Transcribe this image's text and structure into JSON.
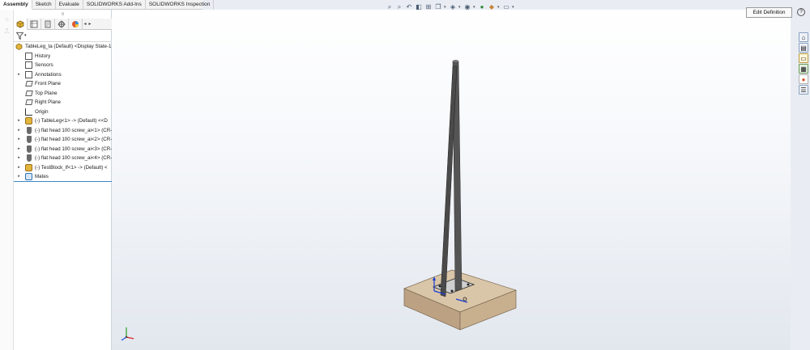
{
  "tabs": [
    {
      "label": "Assembly",
      "active": true
    },
    {
      "label": "Sketch",
      "active": false
    },
    {
      "label": "Evaluate",
      "active": false
    },
    {
      "label": "SOLIDWORKS Add-Ins",
      "active": false
    },
    {
      "label": "SOLIDWORKS Inspection",
      "active": false
    }
  ],
  "panel": {
    "grip": "¤",
    "tab_icons": [
      "feature-manager-icon",
      "property-manager-icon",
      "configuration-manager-icon",
      "dimxpert-manager-icon",
      "display-manager-icon"
    ],
    "tree": [
      {
        "label": "TableLeg_ta (Default) <Display State-1",
        "icon": "assembly-icon",
        "expander": false,
        "level": 0
      },
      {
        "label": "History",
        "icon": "history-icon",
        "expander": false,
        "level": 1
      },
      {
        "label": "Sensors",
        "icon": "sensors-icon",
        "expander": false,
        "level": 1
      },
      {
        "label": "Annotations",
        "icon": "annotations-icon",
        "expander": true,
        "level": 1
      },
      {
        "label": "Front Plane",
        "icon": "plane-icon",
        "expander": false,
        "level": 1
      },
      {
        "label": "Top Plane",
        "icon": "plane-icon",
        "expander": false,
        "level": 1
      },
      {
        "label": "Right Plane",
        "icon": "plane-icon",
        "expander": false,
        "level": 1
      },
      {
        "label": "Origin",
        "icon": "origin-icon",
        "expander": false,
        "level": 1
      },
      {
        "label": "(-) TableLeg<1> -> (Default) <<D",
        "icon": "part-icon",
        "expander": true,
        "level": 1
      },
      {
        "label": "(-) flat head 100 screw_ai<1> (CR-",
        "icon": "screw-icon",
        "expander": true,
        "level": 1
      },
      {
        "label": "(-) flat head 100 screw_ai<2> (CR-",
        "icon": "screw-icon",
        "expander": true,
        "level": 1
      },
      {
        "label": "(-) flat head 100 screw_ai<3> (CR-",
        "icon": "screw-icon",
        "expander": true,
        "level": 1
      },
      {
        "label": "(-) flat head 100 screw_ai<4> (CR-",
        "icon": "screw-icon",
        "expander": true,
        "level": 1
      },
      {
        "label": "(-) TestBlock_lf<1> -> (Default) <",
        "icon": "part-icon",
        "expander": true,
        "level": 1
      },
      {
        "label": "Mates",
        "icon": "mates-icon",
        "expander": true,
        "level": 1
      }
    ]
  },
  "heads_up": [
    "zoom-to-fit-icon",
    "zoom-to-area-icon",
    "previous-view-icon",
    "section-view-icon",
    "dynamic-annotation-icon",
    "view-orientation-icon",
    "display-style-icon",
    "hide-show-items-icon",
    "edit-appearance-icon",
    "apply-scene-icon",
    "view-settings-icon"
  ],
  "edit_definition_label": "Edit Definition",
  "help_label": "?",
  "task_pane": [
    "solidworks-resources-icon",
    "design-library-icon",
    "file-explorer-icon",
    "view-palette-icon",
    "appearances-icon",
    "custom-properties-icon"
  ],
  "colors": {
    "block_top": "#d6c2a6",
    "block_side": "#b59b7a",
    "leg": "#4d4d4d",
    "selection": "#3a86c8"
  }
}
